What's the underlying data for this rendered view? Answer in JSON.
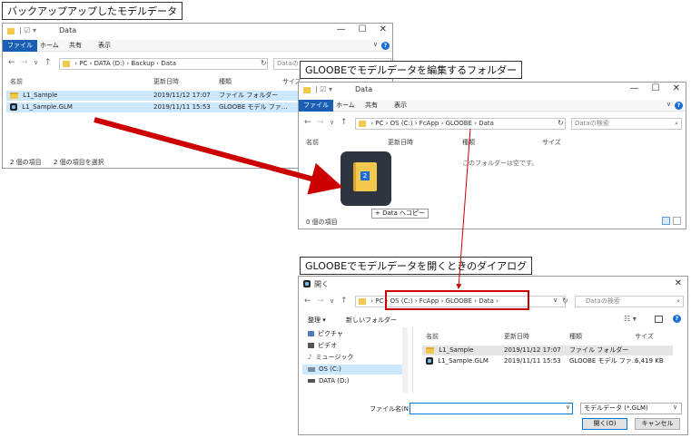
{
  "labels": {
    "backup": "バックアップアップしたモデルデータ",
    "edit": "GLOOBEでモデルデータを編集するフォルダー",
    "dialog": "GLOOBEでモデルデータを開くときのダイアログ"
  },
  "w1": {
    "title": "Data",
    "tabs": [
      "ファイル",
      "ホーム",
      "共有",
      "表示"
    ],
    "path": [
      "PC",
      "DATA (D:)",
      "Backup",
      "Data"
    ],
    "search_placeholder": "Dataの",
    "columns": [
      "名前",
      "更新日時",
      "種類",
      "サイズ"
    ],
    "rows": [
      {
        "name": "L1_Sample",
        "date": "2019/11/12 17:07",
        "type": "ファイル フォルダー"
      },
      {
        "name": "L1_Sample.GLM",
        "date": "2019/11/11 15:53",
        "type": "GLOOBE モデル ファ..."
      }
    ],
    "status_count": "2 個の項目",
    "status_selected": "2 個の項目を選択"
  },
  "w2": {
    "title": "Data",
    "tabs": [
      "ファイル",
      "ホーム",
      "共有",
      "表示"
    ],
    "path": [
      "PC",
      "OS (C:)",
      "FcApp",
      "GLOOBE",
      "Data"
    ],
    "search_placeholder": "Dataの検索",
    "columns": [
      "名前",
      "更新日時",
      "種類",
      "サイズ"
    ],
    "empty_message": "このフォルダーは空です。",
    "drag_badge": "2",
    "copy_tooltip": "+ Data へコピー",
    "status_count": "0 個の項目"
  },
  "w3": {
    "title": "開く",
    "path": [
      "PC",
      "OS (C:)",
      "FcApp",
      "GLOOBE",
      "Data"
    ],
    "search_placeholder": "Dataの検索",
    "organize": "整理 ▾",
    "new_folder": "新しいフォルダー",
    "sidebar": [
      "ピクチャ",
      "ビデオ",
      "ミュージック",
      "OS (C:)",
      "DATA (D:)"
    ],
    "columns": [
      "名前",
      "更新日時",
      "種類",
      "サイズ"
    ],
    "rows": [
      {
        "name": "L1_Sample",
        "date": "2019/11/12 17:07",
        "type": "ファイル フォルダー",
        "size": ""
      },
      {
        "name": "L1_Sample.GLM",
        "date": "2019/11/11 15:53",
        "type": "GLOOBE モデル ファ...",
        "size": "6,419 KB"
      }
    ],
    "filename_label": "ファイル名(N):",
    "filename_value": "",
    "filter": "モデルデータ (*.GLM)",
    "open_button": "開く(O)",
    "cancel_button": "キャンセル"
  },
  "colors": {
    "accent_blue": "#1a5fb4",
    "selection": "#cce8ff",
    "arrow_red": "#cc0000"
  }
}
